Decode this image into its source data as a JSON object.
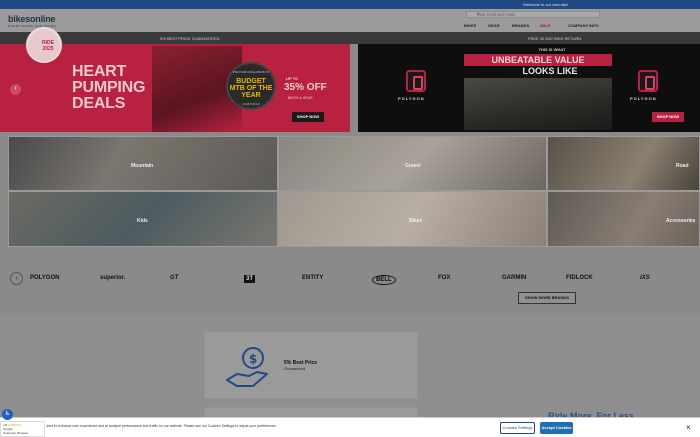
{
  "topbar": {
    "welcome": "Welcome to our new site!"
  },
  "header": {
    "logo": "bikesonline",
    "logo_sub": "EVERYTHING FOR BIKES",
    "search_placeholder": "FIND YOUR NEXT BIKE",
    "nav": [
      "BIKES",
      "GEAR",
      "BRANDS",
      "SALE"
    ],
    "company": "COMPANY INFO"
  },
  "promo_strip": {
    "left": "5% BEST PRICE GUARANTEED",
    "right": "FREE 30 DAY BIKE RETURN"
  },
  "hero_left": {
    "heart_text": "RIDE 2025",
    "title_line1": "HEART",
    "title_line2": "PUMPING",
    "title_line3": "DEALS",
    "badge_top": "POLYGON COLLOSUS N7",
    "badge_main": "BUDGET MTB OF THE YEAR",
    "badge_bottom": "LOAM WOLF",
    "up_to": "UP TO",
    "discount": "35% OFF",
    "discount_sub": "BIKES & GEAR",
    "shop": "SHOP NOW"
  },
  "hero_right": {
    "this_is": "THIS IS WHAT",
    "headline": "UNBEATABLE VALUE",
    "subhead": "LOOKS LIKE",
    "brand": "POLYGON",
    "shop": "SHOP NOW",
    "slide_count": 5,
    "active_slide": 2
  },
  "categories": [
    "Mountain",
    "Gravel",
    "Road",
    "Kids",
    "Bikes",
    "Accessories"
  ],
  "brands": [
    "POLYGON",
    "superior.",
    "GT",
    "3T",
    "ENTITY",
    "BELL",
    "FOX",
    "GARMIN",
    "FIDLOCK",
    "iXS"
  ],
  "show_more": "SHOW MORE BRANDS",
  "features": {
    "title": "5% Best Price",
    "subtitle": "Guaranteed"
  },
  "ride_more": "Ride More, For Less",
  "cookie": {
    "text": "...kies to enhance user experience and to analyze performance and traffic on our website. Please see our Cookies Settings to adjust your preferences.",
    "settings": "Cookies Settings",
    "accept": "Accept Cookies"
  },
  "reviews": {
    "rating": "4.8",
    "stars": "★★★★★",
    "source": "Google",
    "label": "Customer Reviews"
  }
}
